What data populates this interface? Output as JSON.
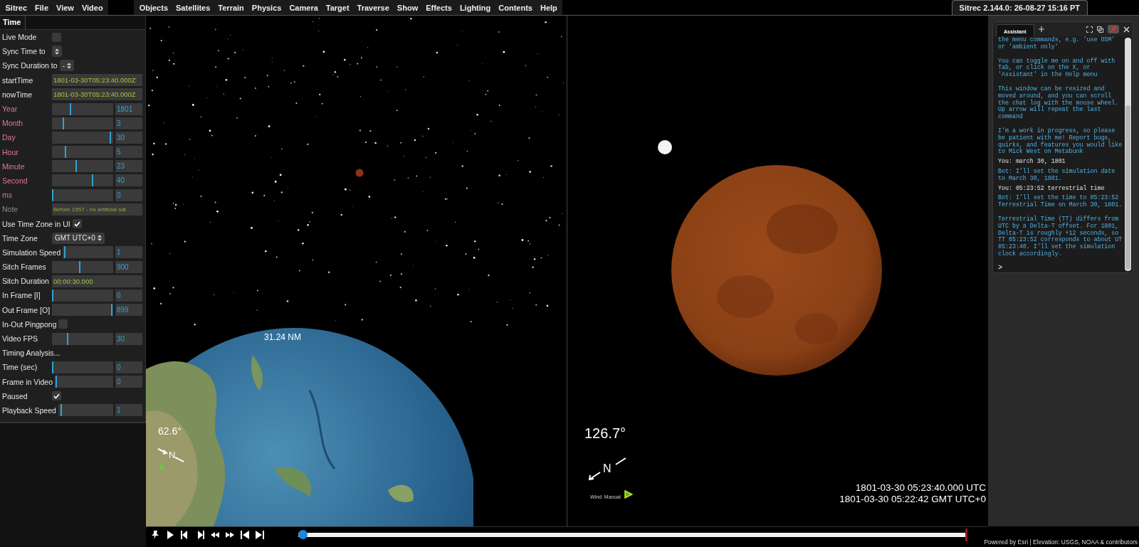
{
  "menu_bar": {
    "left_items": [
      "Sitrec",
      "File",
      "View",
      "Video"
    ],
    "right_items": [
      "Objects",
      "Satellites",
      "Terrain",
      "Physics",
      "Camera",
      "Target",
      "Traverse",
      "Show",
      "Effects",
      "Lighting",
      "Contents",
      "Help"
    ],
    "version_tab": "Sitrec 2.144.0: 26-08-27 15:16 PT"
  },
  "gui_panel": {
    "tab": "Time",
    "rows": [
      {
        "kind": "checkbox",
        "label": "Live Mode",
        "checked": false,
        "highlight": false
      },
      {
        "kind": "select",
        "label": "Sync Time to",
        "highlight": false
      },
      {
        "kind": "select",
        "label": "Sync Duration to",
        "value": "-",
        "highlight": false
      },
      {
        "kind": "text",
        "label": "startTime",
        "value": "1801-03-30T05:23:40.000Z",
        "highlight": false,
        "disabled": false
      },
      {
        "kind": "text",
        "label": "nowTime",
        "value": "1801-03-30T05:23:40.000Z",
        "highlight": false,
        "disabled": false
      },
      {
        "kind": "slider",
        "label": "Year",
        "level": 0.3,
        "value": "1801",
        "highlight": true
      },
      {
        "kind": "slider",
        "label": "Month",
        "level": 0.18,
        "value": "3",
        "highlight": true
      },
      {
        "kind": "slider",
        "label": "Day",
        "level": 0.97,
        "value": "30",
        "highlight": true
      },
      {
        "kind": "slider",
        "label": "Hour",
        "level": 0.21,
        "value": "5",
        "highlight": true
      },
      {
        "kind": "slider",
        "label": "Minute",
        "level": 0.39,
        "value": "23",
        "highlight": true
      },
      {
        "kind": "slider",
        "label": "Second",
        "level": 0.67,
        "value": "40",
        "highlight": true
      },
      {
        "kind": "slider",
        "label": "ms",
        "level": 0,
        "value": "0",
        "highlight": true
      },
      {
        "kind": "text",
        "label": "Note",
        "value": "Before 1957 - no artificial sat",
        "highlight": false,
        "disabled": true
      },
      {
        "kind": "checkbox",
        "label": "Use Time Zone in UI",
        "checked": true,
        "highlight": false
      },
      {
        "kind": "select",
        "label": "Time Zone",
        "value": "GMT UTC+0",
        "highlight": false
      },
      {
        "kind": "slider",
        "label": "Simulation Speed",
        "level": 0.02,
        "value": "1",
        "highlight": false
      },
      {
        "kind": "slider",
        "label": "Sitch Frames",
        "level": 0.45,
        "value": "900",
        "highlight": false
      },
      {
        "kind": "text",
        "label": "Sitch Duration",
        "value": "00:00:30.000",
        "highlight": false,
        "disabled": false
      },
      {
        "kind": "slider",
        "label": "In Frame [I]",
        "level": 0,
        "value": "0",
        "highlight": false
      },
      {
        "kind": "slider",
        "label": "Out Frame [O]",
        "level": 0.99,
        "value": "899",
        "highlight": false
      },
      {
        "kind": "checkbox",
        "label": "In-Out Pingpong",
        "checked": false,
        "highlight": false
      },
      {
        "kind": "slider",
        "label": "Video FPS",
        "level": 0.25,
        "value": "30",
        "highlight": false
      },
      {
        "kind": "button",
        "label": "Timing Analysis...",
        "highlight": false
      },
      {
        "kind": "slider",
        "label": "Time (sec)",
        "level": 0,
        "value": "0",
        "highlight": false
      },
      {
        "kind": "slider",
        "label": "Frame in Video",
        "level": 0.01,
        "value": "0",
        "highlight": false
      },
      {
        "kind": "checkbox",
        "label": "Paused",
        "checked": true,
        "highlight": false
      },
      {
        "kind": "slider",
        "label": "Playback Speed",
        "level": 0.04,
        "value": "1",
        "highlight": false
      }
    ]
  },
  "left_view": {
    "altitude_label": "31.24 NM",
    "heading": "62.6°",
    "compass_letter": "N"
  },
  "right_view": {
    "heading": "126.7°",
    "compass_letter": "N",
    "wind_label": "Wind: Manual",
    "time_utc": "1801-03-30 05:23:40.000 UTC",
    "time_local": "1801-03-30 05:22:42 GMT UTC+0"
  },
  "timeline": {
    "level": 0
  },
  "assistant": {
    "tab": "Assistant",
    "pinned": true,
    "messages": [
      {
        "kind": "tip",
        "text": "the menu commands, e.g. 'use OSM' or 'ambient only'"
      },
      {
        "kind": "tip",
        "text": "You can toggle me on and off with Tab, or click on the X, or 'Assistant' in the Help menu"
      },
      {
        "kind": "tip",
        "text": "This window can be resized and moved around, and you can scroll the chat log with the mouse wheel. Up arrow will repeat the last command"
      },
      {
        "kind": "tip",
        "text": "I'm a work in progress, so please be patient with me! Report bugs, quirks, and features you would like to Mick West on Metabunk"
      },
      {
        "kind": "user",
        "text": "You: march 30, 1801"
      },
      {
        "kind": "bot",
        "text": "Bot: I'll set the simulation date to March 30, 1801."
      },
      {
        "kind": "user",
        "text": "You: 05:23:52 terrestrial time"
      },
      {
        "kind": "bot",
        "text": "Bot: I'll set the time to 05:23:52 Terrestrial Time on March 30, 1801."
      },
      {
        "kind": "tip",
        "text": "Terrestrial Time (TT) differs from UTC by a Delta-T offset. For 1801, Delta-T is roughly +12 seconds, so TT 05:23:52 corresponds to about UT 05:23:40. I'll set the simulation clock accordingly."
      },
      {
        "kind": "prompt",
        "text": ">"
      }
    ]
  },
  "footer": "Powered by Esri | Elevation: USGS, NOAA & contributors"
}
